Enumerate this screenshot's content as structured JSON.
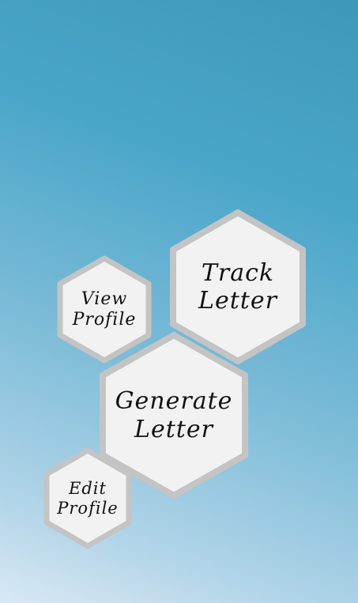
{
  "menu": {
    "track_letter": {
      "line1": "Track",
      "line2": "Letter"
    },
    "view_profile": {
      "line1": "View",
      "line2": "Profile"
    },
    "generate_letter": {
      "line1": "Generate",
      "line2": "Letter"
    },
    "edit_profile": {
      "line1": "Edit",
      "line2": "Profile"
    }
  },
  "colors": {
    "hex_fill": "#f2f2f2",
    "hex_border": "#c4c4c4",
    "background_top": "#3e98b9",
    "background_bottom": "#dae8f4"
  }
}
